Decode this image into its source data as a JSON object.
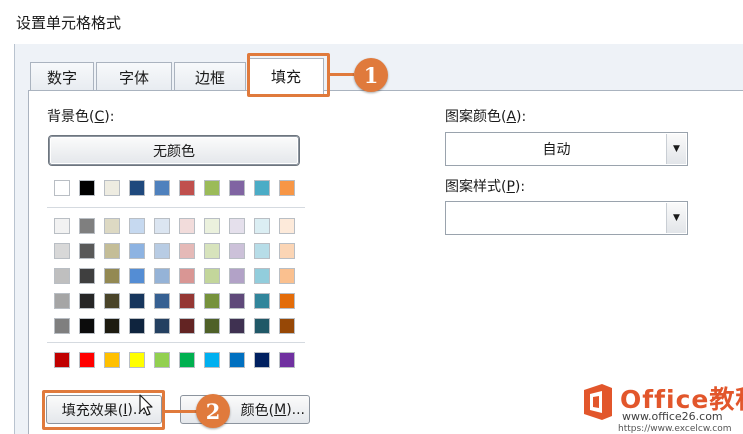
{
  "window": {
    "title": "设置单元格格式"
  },
  "tabs": [
    {
      "label": "数字"
    },
    {
      "label": "字体"
    },
    {
      "label": "边框"
    },
    {
      "label": "填充"
    }
  ],
  "background_color": {
    "label": "背景色",
    "accel": "C",
    "no_color_button": "无颜色",
    "theme_top_row": [
      "#ffffff",
      "#000000",
      "#eeece1",
      "#1f497d",
      "#4f81bd",
      "#c0504d",
      "#9bbb59",
      "#8064a2",
      "#4bacc6",
      "#f79646"
    ],
    "theme_shades": [
      [
        "#f2f2f2",
        "#7f7f7f",
        "#ddd9c3",
        "#c6d9f0",
        "#dbe5f1",
        "#f2dcdb",
        "#ebf1dd",
        "#e5e0ec",
        "#dbeef3",
        "#fdeada"
      ],
      [
        "#d8d8d8",
        "#595959",
        "#c4bd97",
        "#8db3e2",
        "#b8cce4",
        "#e5b9b7",
        "#d7e3bc",
        "#ccc1d9",
        "#b7dde8",
        "#fbd5b5"
      ],
      [
        "#bfbfbf",
        "#3f3f3f",
        "#938953",
        "#548dd4",
        "#95b3d7",
        "#d99694",
        "#c3d69b",
        "#b2a2c7",
        "#92cddc",
        "#fac08f"
      ],
      [
        "#a5a5a5",
        "#262626",
        "#494429",
        "#17365d",
        "#366092",
        "#953734",
        "#76923c",
        "#5f497a",
        "#31859b",
        "#e36c09"
      ],
      [
        "#7f7f7f",
        "#0c0c0c",
        "#1d1b10",
        "#0f243e",
        "#244061",
        "#632423",
        "#4f6128",
        "#3f3151",
        "#205867",
        "#974806"
      ]
    ],
    "standard_colors": [
      "#c00000",
      "#ff0000",
      "#ffc000",
      "#ffff00",
      "#92d050",
      "#00b050",
      "#00b0f0",
      "#0070c0",
      "#002060",
      "#7030a0"
    ]
  },
  "pattern_color": {
    "label": "图案颜色",
    "accel": "A",
    "value": "自动"
  },
  "pattern_style": {
    "label": "图案样式",
    "accel": "P",
    "value": ""
  },
  "buttons": {
    "fill_effects_prefix": "填充效果(",
    "fill_effects_accel": "I",
    "fill_effects_suffix": ")...",
    "more_colors_partial": "颜色(",
    "more_colors_accel": "M",
    "more_colors_suffix": ")..."
  },
  "callouts": {
    "step1": "1",
    "step2": "2"
  },
  "annotation_color": "#e07a3c",
  "watermark": {
    "brand": "Office教程网",
    "url1": "www.office26.com",
    "url2": "https://www.excelcw.com"
  }
}
